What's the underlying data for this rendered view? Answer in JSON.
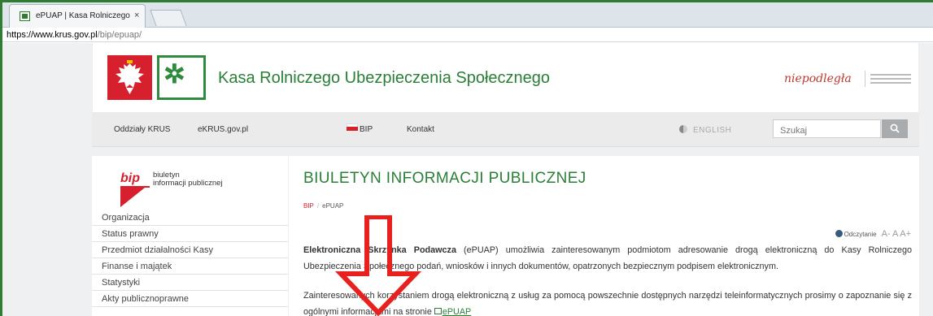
{
  "browser": {
    "tab_title": "ePUAP | Kasa Rolniczego",
    "tab_close": "×",
    "url_host": "https://www.krus.gov.pl",
    "url_path": "/bip/epuap/"
  },
  "header": {
    "site_title": "Kasa Rolniczego Ubezpieczenia Społecznego",
    "niepodlegla": "niepodległa"
  },
  "nav": {
    "items": [
      "Oddziały KRUS",
      "eKRUS.gov.pl",
      "BIP",
      "Kontakt"
    ],
    "english": "ENGLISH",
    "search_placeholder": "Szukaj"
  },
  "sidebar": {
    "bip_word": "bip",
    "bip_line1": "biuletyn",
    "bip_line2": "informacji publicznej",
    "menu": [
      "Organizacja",
      "Status prawny",
      "Przedmiot działalności Kasy",
      "Finanse i majątek",
      "Statystyki",
      "Akty publicznoprawne"
    ]
  },
  "main": {
    "title": "BIULETYN INFORMACJI PUBLICZNEJ",
    "breadcrumb_link": "BIP",
    "breadcrumb_sep": "/",
    "breadcrumb_current": "ePUAP",
    "odczytanie": "Odczytanie",
    "font_tools": "A- A A+",
    "para1_bold": "Elektroniczna Skrzynka Podawcza",
    "para1_rest": " (ePUAP) umożliwia zainteresowanym podmiotom adresowanie drogą elektroniczną do Kasy Rolniczego Ubezpieczenia Społecznego podań, wniosków i innych dokumentów, opatrzonych bezpiecznym podpisem elektronicznym.",
    "para2": "Zainteresowanych korzystaniem drogą elektroniczną z usług za pomocą powszechnie dostępnych narzędzi teleinformatycznych prosimy o zapoznanie się z ogólnymi informacjami na stronie ",
    "epuap_link": "ePUAP"
  },
  "colors": {
    "brand_green": "#2a7f36",
    "brand_red": "#d6202e",
    "annotation_arrow": "#e8201e"
  }
}
